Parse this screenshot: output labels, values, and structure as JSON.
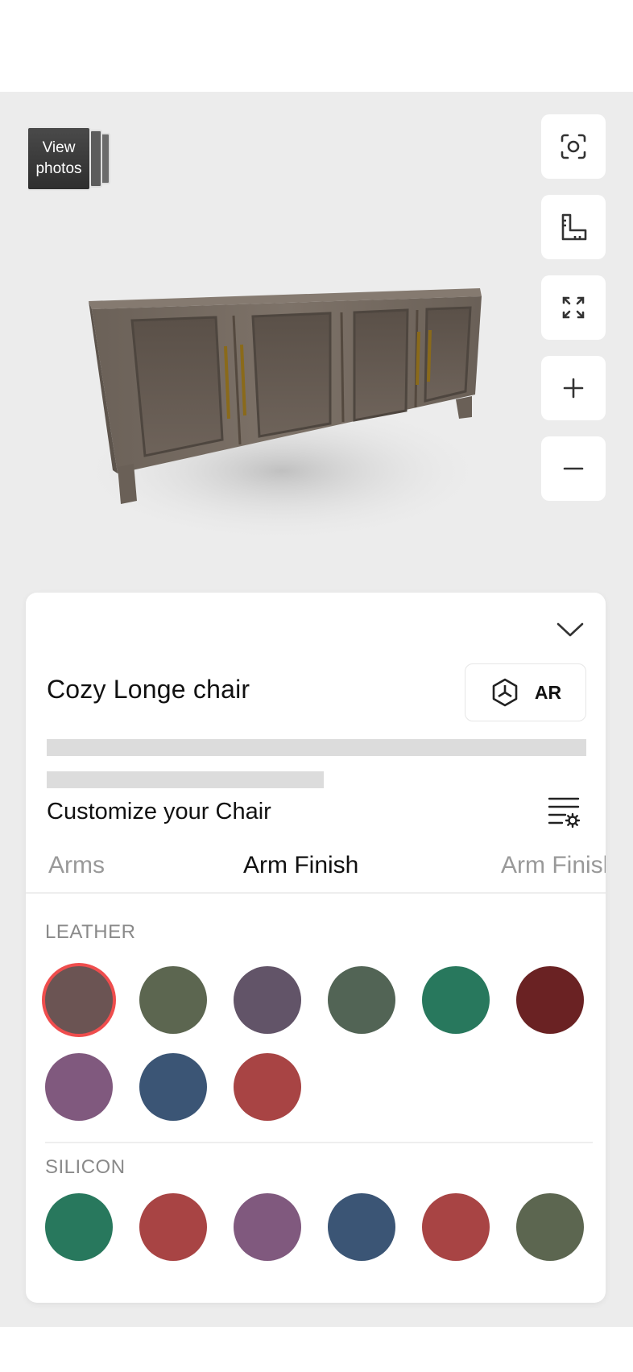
{
  "viewer": {
    "view_photos_label": "View photos",
    "tools": [
      {
        "name": "focus-button",
        "icon": "focus-icon"
      },
      {
        "name": "measure-button",
        "icon": "ruler-icon"
      },
      {
        "name": "fullscreen-button",
        "icon": "fullscreen-icon"
      },
      {
        "name": "zoom-in-button",
        "icon": "plus-icon"
      },
      {
        "name": "zoom-out-button",
        "icon": "minus-icon"
      }
    ]
  },
  "product": {
    "title": "Cozy Longe chair",
    "ar_label": "AR",
    "customize_label": "Customize your Chair"
  },
  "tabs": [
    {
      "label": "Arms",
      "active": false
    },
    {
      "label": "Arm Finish",
      "active": true
    },
    {
      "label": "Arm Finish",
      "active": false
    }
  ],
  "sections": [
    {
      "label": "LEATHER",
      "swatches": [
        "#6b5453",
        "#5c6650",
        "#625468",
        "#526455",
        "#28785d",
        "#6a2223",
        "#80597e",
        "#3b5575",
        "#a84444"
      ],
      "selected_index": 0
    },
    {
      "label": "SILICON",
      "swatches": [
        "#28785d",
        "#a84444",
        "#80597e",
        "#3b5575",
        "#a84444",
        "#5c6650"
      ],
      "selected_index": -1
    }
  ]
}
